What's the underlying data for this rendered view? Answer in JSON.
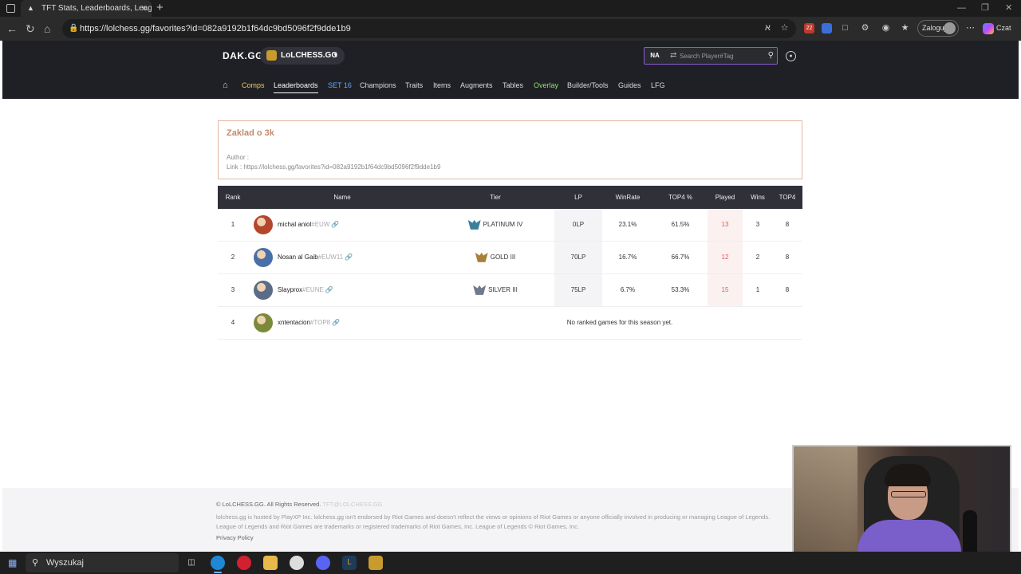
{
  "browser": {
    "tab_title": "TFT Stats, Leaderboards, League of",
    "url": "https://lolchess.gg/favorites?id=082a9192b1f64dc9bd5096f2f9dde1b9",
    "login_label": "Zaloguj",
    "chat_label": "Czat",
    "ext_badge": "22"
  },
  "site": {
    "logo": "DAK.GG",
    "site_switch": "LoLCHESS.GG",
    "region": "NA",
    "search_placeholder": "Search Player#Tag"
  },
  "nav": {
    "items": [
      {
        "label": "Comps",
        "color": "#f0c75e"
      },
      {
        "label": "Leaderboards",
        "color": "#ffffff"
      },
      {
        "label": "SET 16",
        "color": "#5aa9ff"
      },
      {
        "label": "Champions",
        "color": "#dddddd"
      },
      {
        "label": "Traits",
        "color": "#dddddd"
      },
      {
        "label": "Items",
        "color": "#dddddd"
      },
      {
        "label": "Augments",
        "color": "#dddddd"
      },
      {
        "label": "Tables",
        "color": "#dddddd"
      },
      {
        "label": "Overlay",
        "color": "#8fe35a"
      },
      {
        "label": "Builder/Tools",
        "color": "#dddddd"
      },
      {
        "label": "Guides",
        "color": "#dddddd"
      },
      {
        "label": "LFG",
        "color": "#dddddd"
      }
    ]
  },
  "favorite": {
    "title": "Zaklad o 3k",
    "author_line": "Author :",
    "link_line": "Link : https://lolchess.gg/favorites?id=082a9192b1f64dc9bd5096f2f9dde1b9"
  },
  "table": {
    "headers": [
      "Rank",
      "Name",
      "Tier",
      "LP",
      "WinRate",
      "TOP4 %",
      "Played",
      "Wins",
      "TOP4"
    ],
    "rows": [
      {
        "rank": "1",
        "name": "michal aniol",
        "tag": "#EUW",
        "tier": "PLATINUM IV",
        "tier_color": "#3d7f9a",
        "lp": "0LP",
        "winrate": "23.1%",
        "top4pct": "61.5%",
        "played": "13",
        "wins": "3",
        "top4": "8",
        "avatar": "#b5462e"
      },
      {
        "rank": "2",
        "name": "Nosan al Gaib",
        "tag": "#EUW11",
        "tier": "GOLD III",
        "tier_color": "#a8803a",
        "lp": "70LP",
        "winrate": "16.7%",
        "top4pct": "66.7%",
        "played": "12",
        "wins": "2",
        "top4": "8",
        "avatar": "#4a6fa8"
      },
      {
        "rank": "3",
        "name": "Slayprox",
        "tag": "#EUNE",
        "tier": "SILVER III",
        "tier_color": "#6f7a8a",
        "lp": "75LP",
        "winrate": "6.7%",
        "top4pct": "53.3%",
        "played": "15",
        "wins": "1",
        "top4": "8",
        "avatar": "#5b6c86"
      },
      {
        "rank": "4",
        "name": "xntentacion",
        "tag": "#TOP8",
        "avatar": "#7b8a3a",
        "no_games": "No ranked games for this season yet."
      }
    ]
  },
  "footer": {
    "copyright": "© LoLCHESS.GG. All Rights Reserved.",
    "email": "TFT@LOLCHESS.GG",
    "disclaimer": "lolchess.gg is hosted by PlayXP Inc. lolchess.gg isn't endorsed by Riot Games and doesn't reflect the views or opinions of Riot Games or anyone officially involved in producing or managing League of Legends. League of Legends and Riot Games are trademarks or registered trademarks of Riot Games, Inc. League of Legends © Riot Games, Inc.",
    "privacy": "Privacy Policy"
  },
  "taskbar": {
    "search_label": "Wyszukaj"
  }
}
